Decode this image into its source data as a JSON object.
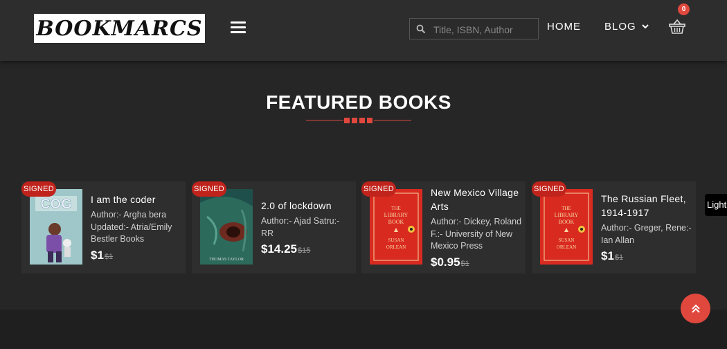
{
  "header": {
    "logo_text": "BOOKMARCS",
    "search_placeholder": "Title, ISBN, Author",
    "nav": [
      {
        "label": "HOME"
      },
      {
        "label": "BLOG"
      }
    ],
    "cart_count": "0"
  },
  "section": {
    "title": "FEATURED BOOKS"
  },
  "books": [
    {
      "badge": "SIGNED",
      "title": "I am the coder",
      "author": "Author:- Argha bera Updated:- Atria/Emily Bestler Books",
      "price": "$1",
      "old_price": "$1",
      "cover": "cog-cover"
    },
    {
      "badge": "SIGNED",
      "title": "2.0 of lockdown",
      "author": "Author:- Ajad Satru:- RR",
      "price": "$14.25",
      "old_price": "$15",
      "cover": "eye-cover"
    },
    {
      "badge": "SIGNED",
      "title": "New Mexico Village Arts",
      "author": "Author:- Dickey, Roland F.:- University of New Mexico Press",
      "price": "$0.95",
      "old_price": "$1",
      "cover": "library-book-cover"
    },
    {
      "badge": "SIGNED",
      "title": "The Russian Fleet, 1914-1917",
      "author": "Author:- Greger, Rene:- Ian Allan",
      "price": "$1",
      "old_price": "$1",
      "cover": "library-book-cover"
    }
  ],
  "side_tab": {
    "label": "Light"
  },
  "colors": {
    "accent": "#e0483e",
    "badge": "#c0231b",
    "background": "#262626",
    "card": "#2e2e2e"
  }
}
